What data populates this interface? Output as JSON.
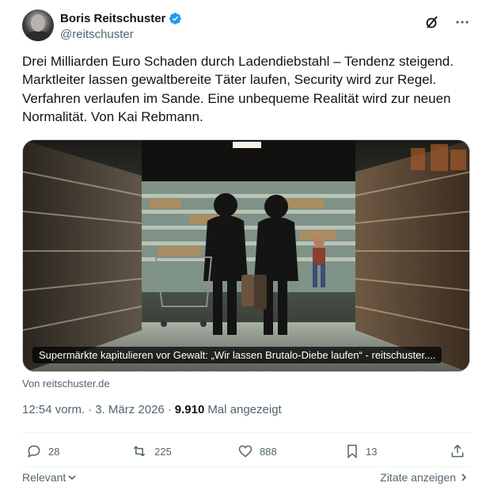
{
  "author": {
    "name": "Boris Reitschuster",
    "handle": "@reitschuster",
    "verified_color": "#1d9bf0"
  },
  "tweet": {
    "text": "Drei Milliarden Euro Schaden durch Ladendiebstahl – Tendenz steigend. Marktleiter lassen gewaltbereite Täter laufen, Security wird zur Regel. Verfahren verlaufen im Sande. Eine unbequeme Realität wird zur neuen Normalität. Von Kai Rebmann."
  },
  "card": {
    "title": "Supermärkte kapitulieren vor Gewalt: „Wir lassen Brutalo-Diebe laufen“ - reitschuster....",
    "source": "Von reitschuster.de",
    "image_icon": "supermarket-photo"
  },
  "meta": {
    "time": "12:54 vorm.",
    "separator": "·",
    "date": "3. März 2026",
    "separator2": "·",
    "views": "9.910",
    "views_label": "Mal angezeigt"
  },
  "actions": {
    "replies": "28",
    "reposts": "225",
    "likes": "888",
    "bookmarks": "13"
  },
  "footer": {
    "relevant": "Relevant",
    "quotes": "Zitate anzeigen"
  },
  "icons": [
    "grok-icon",
    "more-icon",
    "reply-icon",
    "repost-icon",
    "like-icon",
    "bookmark-icon",
    "share-icon"
  ]
}
